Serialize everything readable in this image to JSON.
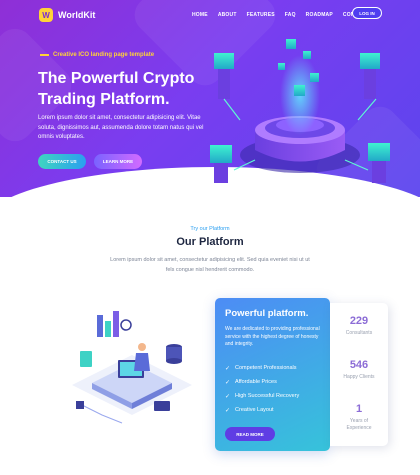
{
  "brand": {
    "name": "WorldKit",
    "logo_glyph": "W"
  },
  "nav": {
    "items": [
      "HOME",
      "ABOUT",
      "FEATURES",
      "FAQ",
      "ROADMAP",
      "CONTACT"
    ],
    "login_label": "LOG IN"
  },
  "hero": {
    "tagline": "Creative ICO landing page template",
    "headline": "The Powerful Crypto Trading Platform.",
    "description": "Lorem ipsum dolor sit amet, consectetur adipisicing elit. Vitae soluta, dignissimos aut, assumenda dolore totam natus qui vel omnis voluptates.",
    "contact_label": "CONTACT US",
    "learn_label": "LEARN MORE"
  },
  "platform_section": {
    "tag": "Try our Platform",
    "title": "Our Platform",
    "description": "Lorem ipsum dolor sit amet, consectetur adipisicing elit. Sed quia eveniet nisi ut ut fels congue nisl hendrerit commodo."
  },
  "platform_card": {
    "title": "Powerful platform.",
    "description": "We are dedicated to providing professional service with the highest degree of honesty and integrity.",
    "features": [
      "Competent Professionals",
      "Affordable Prices",
      "High Successful Recovery",
      "Creative Layout"
    ],
    "read_more_label": "READ MORE"
  },
  "stats": [
    {
      "value": "229",
      "label": "Consultants"
    },
    {
      "value": "546",
      "label": "Happy Clients"
    },
    {
      "value": "1",
      "label": "Years of Experience"
    }
  ],
  "colors": {
    "hero_start": "#8f2fd6",
    "hero_end": "#5b45ee",
    "accent_yellow": "#ffd338",
    "accent_blue": "#2b9ff0",
    "card_start": "#4d8cf5",
    "card_end": "#36c3da",
    "stat_purple": "#8c6cd6"
  }
}
